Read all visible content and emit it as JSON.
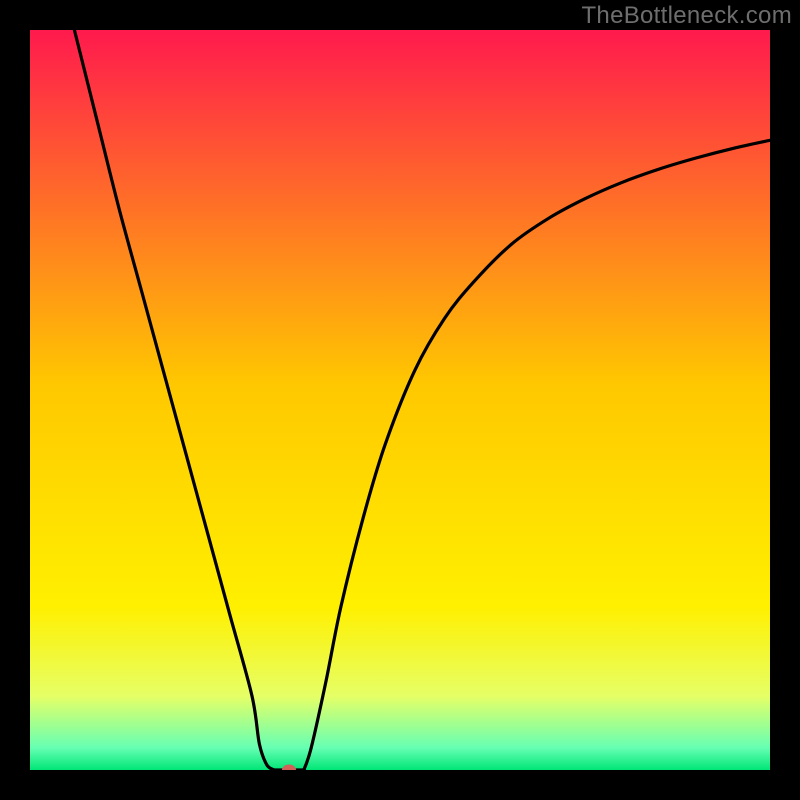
{
  "watermark": "TheBottleneck.com",
  "chart_data": {
    "type": "line",
    "title": "",
    "xlabel": "",
    "ylabel": "",
    "xlim": [
      0,
      100
    ],
    "ylim": [
      0,
      100
    ],
    "grid": false,
    "legend": false,
    "gradient_stops": [
      {
        "pos": 0.0,
        "color": "#ff1a4d"
      },
      {
        "pos": 0.48,
        "color": "#ffc800"
      },
      {
        "pos": 0.78,
        "color": "#fff000"
      },
      {
        "pos": 0.9,
        "color": "#e6ff66"
      },
      {
        "pos": 0.97,
        "color": "#66ffb3"
      },
      {
        "pos": 1.0,
        "color": "#00e676"
      }
    ],
    "series": [
      {
        "name": "left-branch",
        "x": [
          6,
          9,
          12,
          15,
          18,
          21,
          24,
          27,
          30,
          31,
          32,
          33
        ],
        "values": [
          100,
          88,
          76,
          65,
          54,
          43,
          32,
          21,
          10,
          3.5,
          0.7,
          0
        ]
      },
      {
        "name": "trough",
        "x": [
          33,
          35,
          37
        ],
        "values": [
          0,
          0,
          0
        ]
      },
      {
        "name": "right-branch",
        "x": [
          37,
          38,
          40,
          42,
          45,
          48,
          52,
          56,
          60,
          65,
          70,
          75,
          80,
          85,
          90,
          95,
          100
        ],
        "values": [
          0,
          3,
          12,
          22,
          34,
          44,
          54,
          61,
          66,
          71,
          74.5,
          77.2,
          79.4,
          81.2,
          82.7,
          84.0,
          85.1
        ]
      }
    ],
    "marker": {
      "x": 35,
      "y": 0,
      "color": "#d26257",
      "rx": 7,
      "ry": 5.5
    }
  }
}
